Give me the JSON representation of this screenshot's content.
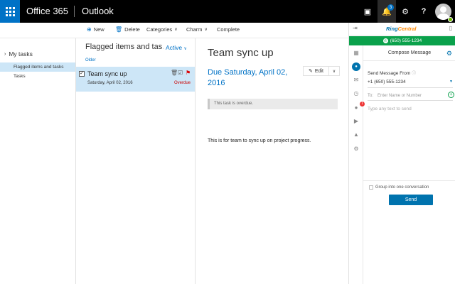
{
  "topbar": {
    "brand": "Office 365",
    "app": "Outlook",
    "icons": [
      "waffle-icon",
      "skype-icon",
      "bell-icon",
      "gear-icon",
      "help-icon"
    ],
    "notification_count": "3",
    "help_label": "?"
  },
  "commands": {
    "new": "New",
    "delete": "Delete",
    "categories": "Categories",
    "charm": "Charm",
    "complete": "Complete"
  },
  "nav": {
    "group": "My tasks",
    "items": [
      {
        "label": "Flagged items and tasks",
        "selected": true
      },
      {
        "label": "Tasks",
        "selected": false
      }
    ]
  },
  "tasklist": {
    "title": "Flagged items and tas…",
    "filter": "Active",
    "section": "Older",
    "tasks": [
      {
        "title": "Team sync up",
        "date": "Saturday, April 02, 2016",
        "status": "Overdue"
      }
    ]
  },
  "reading": {
    "title": "Team sync up",
    "due": "Due Saturday, April 02, 2016",
    "edit_label": "Edit",
    "alert": "This task is overdue.",
    "body": "This is for team to sync up on project progress."
  },
  "ringcentral": {
    "logo_ring": "Ring",
    "logo_central": "Central",
    "phone": "(650) 555-1234",
    "compose_title": "Compose Message",
    "send_from_label": "Send Message From",
    "send_from_value": "+1 (650) 555-1234",
    "to_label": "To:",
    "to_placeholder": "Enter Name or Number",
    "text_placeholder": "Type any text to send",
    "group_label": "Group into one conversation",
    "send_label": "Send",
    "side_badge": "1",
    "accent": "#0073ae",
    "online_color": "#0aa14b"
  },
  "colors": {
    "brand_blue": "#0072c6",
    "selection": "#cde6f7",
    "overdue": "#cc0000"
  }
}
